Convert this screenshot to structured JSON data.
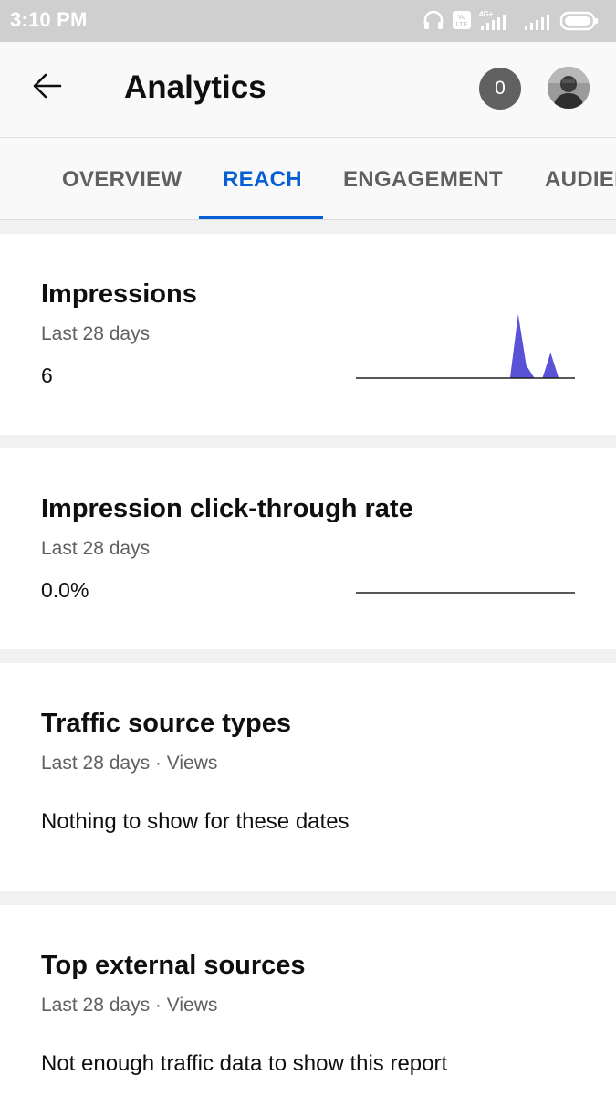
{
  "status_bar": {
    "time": "3:10 PM",
    "icons": [
      "headset-icon",
      "volte-icon",
      "signal-4g-icon",
      "signal-icon",
      "battery-icon"
    ]
  },
  "app_bar": {
    "title": "Analytics",
    "notification_count": "0",
    "icons": [
      "back-arrow-icon",
      "avatar"
    ]
  },
  "tabs": {
    "items": [
      "OVERVIEW",
      "REACH",
      "ENGAGEMENT",
      "AUDIENCE"
    ],
    "visible_last": "AUDIEI",
    "active": "REACH",
    "active_color": "#065fd4"
  },
  "cards": [
    {
      "title": "Impressions",
      "subtitle": "Last 28 days",
      "value": "6",
      "sparkline": {
        "type": "area",
        "color": "#5a52d6",
        "points": [
          0,
          0,
          0,
          0,
          0,
          0,
          0,
          0,
          0,
          0,
          0,
          0,
          0,
          0,
          0,
          0,
          0,
          0,
          0,
          0,
          5,
          1,
          0,
          0,
          2,
          0,
          0,
          0
        ]
      }
    },
    {
      "title": "Impression click-through rate",
      "subtitle": "Last 28 days",
      "value": "0.0%",
      "sparkline": {
        "type": "line",
        "color": "#202020",
        "points": [
          0,
          0,
          0,
          0,
          0,
          0,
          0,
          0,
          0,
          0,
          0,
          0,
          0,
          0,
          0,
          0,
          0,
          0,
          0,
          0,
          0,
          0,
          0,
          0,
          0,
          0,
          0,
          0
        ]
      }
    },
    {
      "title": "Traffic source types",
      "subtitle": "Last 28 days · Views",
      "message": "Nothing to show for these dates"
    },
    {
      "title": "Top external sources",
      "subtitle": "Last 28 days · Views",
      "message": "Not enough traffic data to show this report"
    }
  ]
}
